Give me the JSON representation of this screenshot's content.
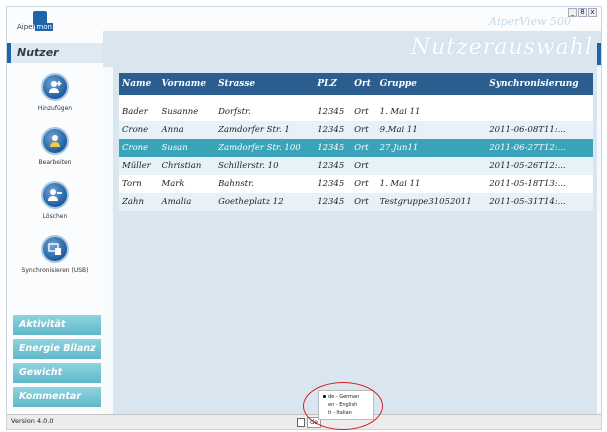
{
  "app": {
    "brand": "Aiper",
    "brand_highlight": "mon",
    "product": "AiperView 500"
  },
  "window_buttons": [
    "_",
    "8",
    "x"
  ],
  "sidebar_header": "Nutzer",
  "page_title": "Nutzerauswahl",
  "actions": [
    {
      "label": "Hinzufügen",
      "icon": "add-user-icon"
    },
    {
      "label": "Bearbeiten",
      "icon": "edit-user-icon"
    },
    {
      "label": "Löschen",
      "icon": "delete-user-icon"
    },
    {
      "label": "Synchronisieren (USB)",
      "icon": "sync-usb-icon"
    }
  ],
  "nav": [
    "Aktivität",
    "Energie Bilanz",
    "Gewicht",
    "Kommentar"
  ],
  "table": {
    "headers": [
      "Name",
      "Vorname",
      "Strasse",
      "PLZ",
      "Ort",
      "Gruppe",
      "Synchronisierung"
    ],
    "rows": [
      [
        "Bader",
        "Susanne",
        "Dorfstr.",
        "12345",
        "Ort",
        "1. Mai 11",
        ""
      ],
      [
        "Crone",
        "Anna",
        "Zamdorfer Str. 1",
        "12345",
        "Ort",
        "9.Mai 11",
        "2011-06-08T11:..."
      ],
      [
        "Crone",
        "Susan",
        "Zamdorfer Str. 100",
        "12345",
        "Ort",
        "27.Jun11",
        "2011-06-27T12:..."
      ],
      [
        "Müller",
        "Christian",
        "Schillerstr. 10",
        "12345",
        "Ort",
        "",
        "2011-05-26T12:..."
      ],
      [
        "Torn",
        "Mark",
        "Bahnstr.",
        "12345",
        "Ort",
        "1. Mai 11",
        "2011-05-18T13:..."
      ],
      [
        "Zahn",
        "Amalia",
        "Goetheplatz 12",
        "12345",
        "Ort",
        "Testgruppe31052011",
        "2011-05-31T14:..."
      ]
    ],
    "selected_row": 2
  },
  "status": {
    "version": "Version 4.0.0",
    "language_value": "de",
    "language_options": [
      "de - German",
      "en - English",
      "it - Italian"
    ]
  },
  "colors": {
    "accent": "#1e64a8",
    "header": "#2b5e8e",
    "selected": "#3aa3b8",
    "nav": "#6cc0cf"
  }
}
